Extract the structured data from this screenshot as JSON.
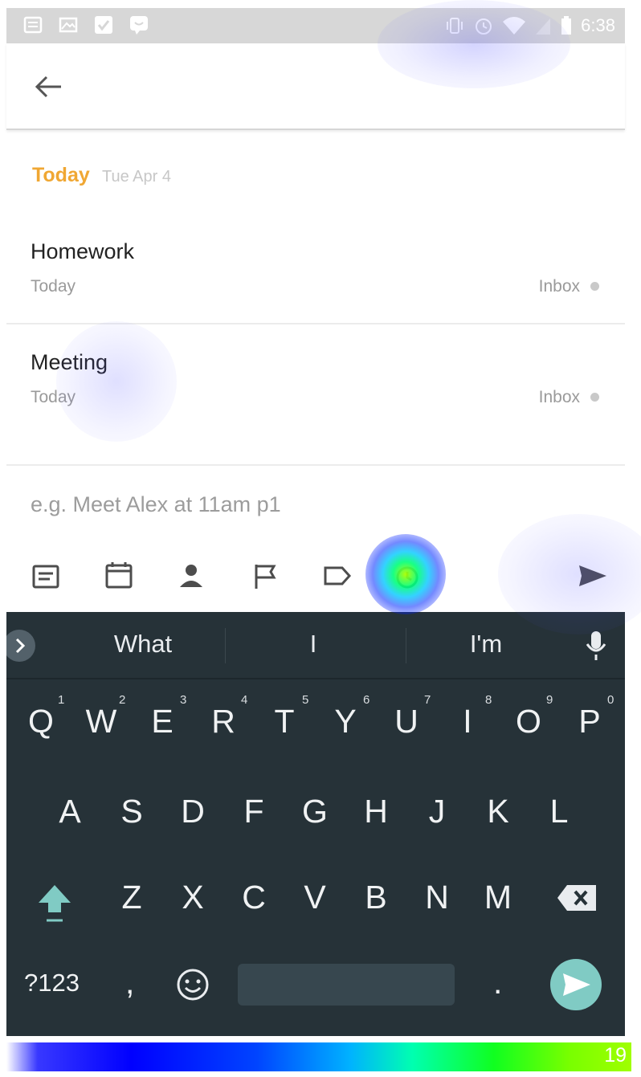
{
  "status_bar": {
    "time": "6:38",
    "notification_icons": [
      "news-icon",
      "gallery-icon",
      "check-icon",
      "chat-icon"
    ],
    "system_icons": [
      "vibrate-icon",
      "alarm-icon",
      "wifi-icon",
      "signal-icon",
      "battery-icon"
    ]
  },
  "app_bar": {
    "back_icon": "arrow-left-icon"
  },
  "section": {
    "title": "Today",
    "date": "Tue Apr 4"
  },
  "tasks": [
    {
      "title": "Homework",
      "due": "Today",
      "project": "Inbox"
    },
    {
      "title": "Meeting",
      "due": "Today",
      "project": "Inbox"
    }
  ],
  "quick_add": {
    "placeholder": "e.g. Meet Alex at 11am p1",
    "tools": [
      "notes-icon",
      "calendar-icon",
      "person-icon",
      "flag-icon",
      "label-icon",
      "reminder-icon"
    ],
    "send_icon": "send-icon"
  },
  "keyboard": {
    "suggestions": [
      "What",
      "I",
      "I'm"
    ],
    "row1": [
      "Q",
      "W",
      "E",
      "R",
      "T",
      "Y",
      "U",
      "I",
      "O",
      "P"
    ],
    "row1_hints": [
      "1",
      "2",
      "3",
      "4",
      "5",
      "6",
      "7",
      "8",
      "9",
      "0"
    ],
    "row2": [
      "A",
      "S",
      "D",
      "F",
      "G",
      "H",
      "J",
      "K",
      "L"
    ],
    "row3": [
      "Z",
      "X",
      "C",
      "V",
      "B",
      "N",
      "M"
    ],
    "symbols_key": "?123",
    "comma_key": ",",
    "period_key": ".",
    "accent": "#80cbc4"
  },
  "legend": {
    "value": "19"
  }
}
